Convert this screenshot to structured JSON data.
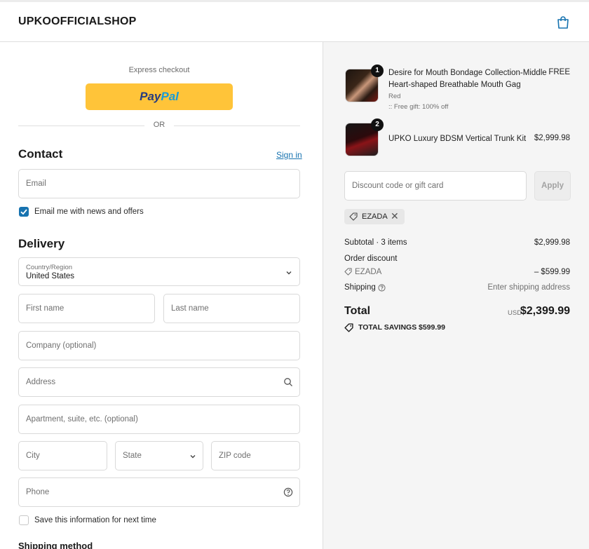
{
  "header": {
    "shop_name": "UPKOOFFICIALSHOP",
    "cart_icon": "shopping-bag-icon"
  },
  "express": {
    "label": "Express checkout",
    "paypal_part1": "Pay",
    "paypal_part2": "Pal",
    "or_label": "OR"
  },
  "contact": {
    "title": "Contact",
    "signin_label": "Sign in",
    "email_placeholder": "Email",
    "newsletter_label": "Email me with news and offers",
    "newsletter_checked": true
  },
  "delivery": {
    "title": "Delivery",
    "country_label": "Country/Region",
    "country_value": "United States",
    "first_name_placeholder": "First name",
    "last_name_placeholder": "Last name",
    "company_placeholder": "Company (optional)",
    "address_placeholder": "Address",
    "apartment_placeholder": "Apartment, suite, etc. (optional)",
    "city_placeholder": "City",
    "state_placeholder": "State",
    "zip_placeholder": "ZIP code",
    "phone_placeholder": "Phone",
    "save_info_label": "Save this information for next time",
    "save_info_checked": false
  },
  "shipping": {
    "title": "Shipping method"
  },
  "cart": {
    "items": [
      {
        "quantity": "1",
        "name_line1": "Desire for Mouth Bondage Collection-Middle",
        "name_line2": "Heart-shaped Breathable Mouth Gag",
        "variant": "Red",
        "note": ":: Free gift: 100% off",
        "price": "FREE"
      },
      {
        "quantity": "2",
        "name_line1": "UPKO Luxury BDSM Vertical Trunk Kit",
        "price": "$2,999.98"
      }
    ],
    "discount_placeholder": "Discount code or gift card",
    "apply_label": "Apply",
    "applied_code": "EZADA",
    "remove_code_symbol": "✕"
  },
  "summary": {
    "subtotal_label": "Subtotal · 3 items",
    "subtotal_value": "$2,999.98",
    "order_discount_label": "Order discount",
    "discount_code": "EZADA",
    "discount_value": "– $599.99",
    "shipping_label": "Shipping",
    "shipping_value": "Enter shipping address",
    "total_label": "Total",
    "currency": "USD",
    "total_value": "$2,399.99",
    "savings_label": "TOTAL SAVINGS",
    "savings_value": "$599.99"
  },
  "colors": {
    "paypal_yellow": "#ffc439",
    "link_blue": "#1773b0",
    "checkbox_blue": "#1773b0",
    "summary_bg": "#f5f5f5"
  }
}
